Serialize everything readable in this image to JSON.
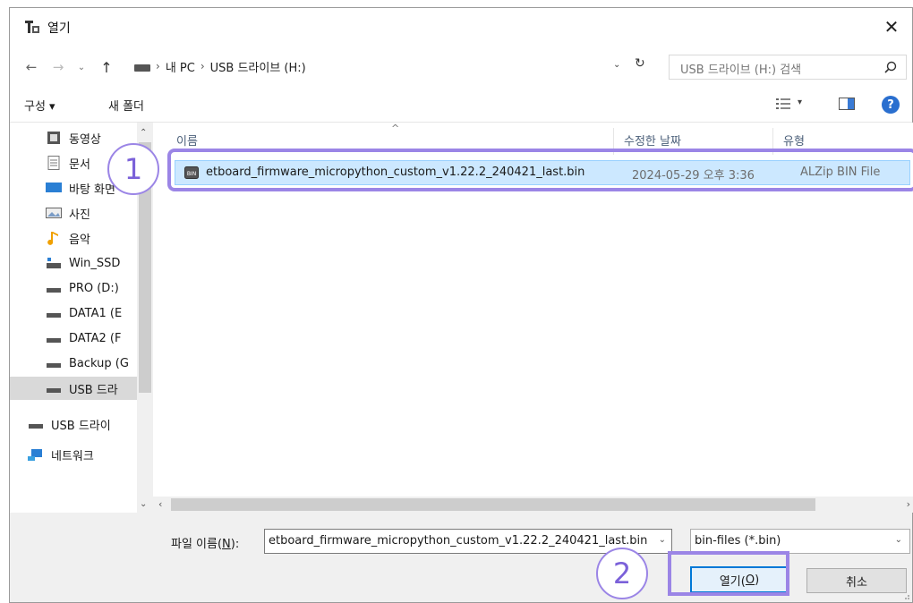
{
  "window": {
    "title": "열기",
    "close_glyph": "✕"
  },
  "nav": {
    "back_glyph": "←",
    "forward_glyph": "→",
    "recent_glyph": "⌄",
    "up_glyph": "↑",
    "breadcrumb": [
      "내 PC",
      "USB 드라이브 (H:)"
    ],
    "separator": "›",
    "dropdown_glyph": "⌄",
    "refresh_glyph": "↻",
    "search_placeholder": "USB 드라이브 (H:) 검색"
  },
  "toolbar": {
    "organize_label": "구성 ▾",
    "new_folder_label": "새 폴더",
    "view_dd_glyph": "▾",
    "help_label": "?"
  },
  "sidebar": {
    "items": [
      {
        "label": "동영상",
        "icon": "video-icon"
      },
      {
        "label": "문서",
        "icon": "document-icon"
      },
      {
        "label": "바탕 화면",
        "icon": "desktop-icon"
      },
      {
        "label": "사진",
        "icon": "picture-icon"
      },
      {
        "label": "음악",
        "icon": "music-icon"
      },
      {
        "label": "Win_SSD",
        "icon": "drive-icon"
      },
      {
        "label": "PRO (D:)",
        "icon": "drive-icon"
      },
      {
        "label": "DATA1 (E",
        "icon": "drive-icon"
      },
      {
        "label": "DATA2 (F",
        "icon": "drive-icon"
      },
      {
        "label": "Backup (G",
        "icon": "drive-icon"
      },
      {
        "label": "USB 드라",
        "icon": "usb-drive-icon",
        "selected": true
      },
      {
        "label": "USB 드라이",
        "icon": "usb-drive-icon"
      },
      {
        "label": "네트워크",
        "icon": "network-icon"
      }
    ],
    "scroll_up_glyph": "⌃",
    "scroll_down_glyph": "⌄"
  },
  "filelist": {
    "columns": {
      "name": "이름",
      "modified": "수정한 날짜",
      "type": "유형"
    },
    "sort_glyph": "^",
    "files": [
      {
        "name": "etboard_firmware_micropython_custom_v1.22.2_240421_last.bin",
        "modified": "2024-05-29 오후 3:36",
        "type": "ALZip BIN File"
      }
    ],
    "hscroll_left": "‹",
    "hscroll_right": "›"
  },
  "footer": {
    "filename_label_prefix": "파일 이름(",
    "filename_label_key": "N",
    "filename_label_suffix": "):",
    "filename_value": "etboard_firmware_micropython_custom_v1.22.2_240421_last.bin",
    "filetype_value": "bin-files (*.bin)",
    "open_label_prefix": "열기(",
    "open_label_key": "O",
    "open_label_suffix": ")",
    "cancel_label": "취소",
    "dd_glyph": "⌄"
  },
  "annotations": {
    "step1": "1",
    "step2": "2",
    "accent": "#9b85e6"
  },
  "colors": {
    "selection": "#cce8ff",
    "selection_border": "#99d1ff",
    "primary_button_border": "#0078d7",
    "help_blue": "#2a6fcf"
  }
}
